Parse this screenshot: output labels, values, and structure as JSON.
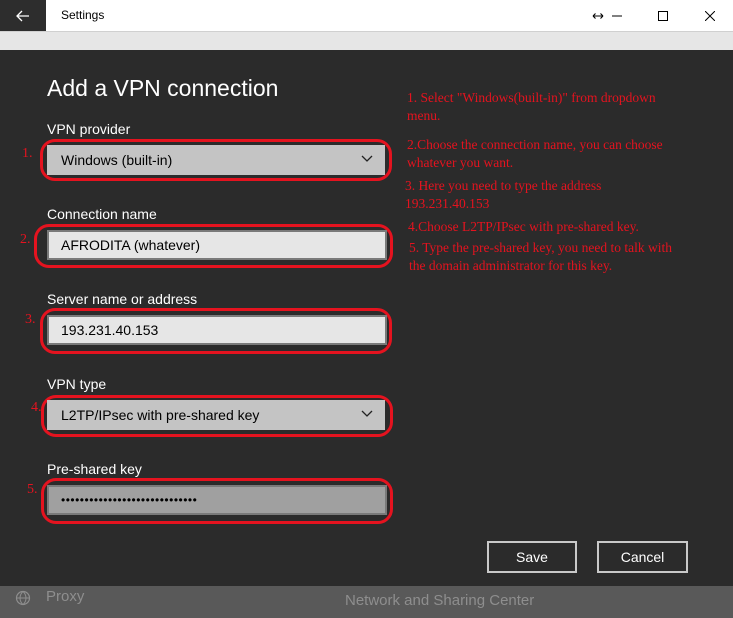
{
  "window": {
    "title": "Settings"
  },
  "background": {
    "proxy_label": "Proxy",
    "network_link": "Network and Sharing Center"
  },
  "dialog": {
    "heading": "Add a VPN connection",
    "fields": {
      "provider": {
        "label": "VPN provider",
        "value": "Windows (built-in)",
        "annotation": "1."
      },
      "connection_name": {
        "label": "Connection name",
        "value": "AFRODITA (whatever)",
        "annotation": "2."
      },
      "server": {
        "label": "Server name or address",
        "value": "193.231.40.153",
        "annotation": "3."
      },
      "vpn_type": {
        "label": "VPN type",
        "value": "L2TP/IPsec with pre-shared key",
        "annotation": "4."
      },
      "psk": {
        "label": "Pre-shared key",
        "value": "•••••••••••••••••••••••••••••",
        "annotation": "5."
      }
    },
    "save_label": "Save",
    "cancel_label": "Cancel"
  },
  "instructions": {
    "n1_line1": "1.  Select \"Windows(built-in)\" from dropdown",
    "n1_line2": "menu.",
    "n2_line1": "2.Choose the connection name, you can choose",
    "n2_line2": "whatever you want.",
    "n3_line1": "3.  Here you need to type the address",
    "n3_line2": "193.231.40.153",
    "n4": "4.Choose L2TP/IPsec with pre-shared key.",
    "n5_line1": "5.  Type the pre-shared key, you need to talk with",
    "n5_line2": "the domain administrator for this key."
  },
  "colors": {
    "annotation_red": "#e5131f",
    "dialog_bg": "#2b2b2b",
    "titlebar_bg": "#ffffff"
  },
  "icons": [
    "back-arrow-icon",
    "resize-icon",
    "minimize-icon",
    "maximize-icon",
    "close-icon",
    "chevron-down-icon",
    "globe-icon"
  ]
}
